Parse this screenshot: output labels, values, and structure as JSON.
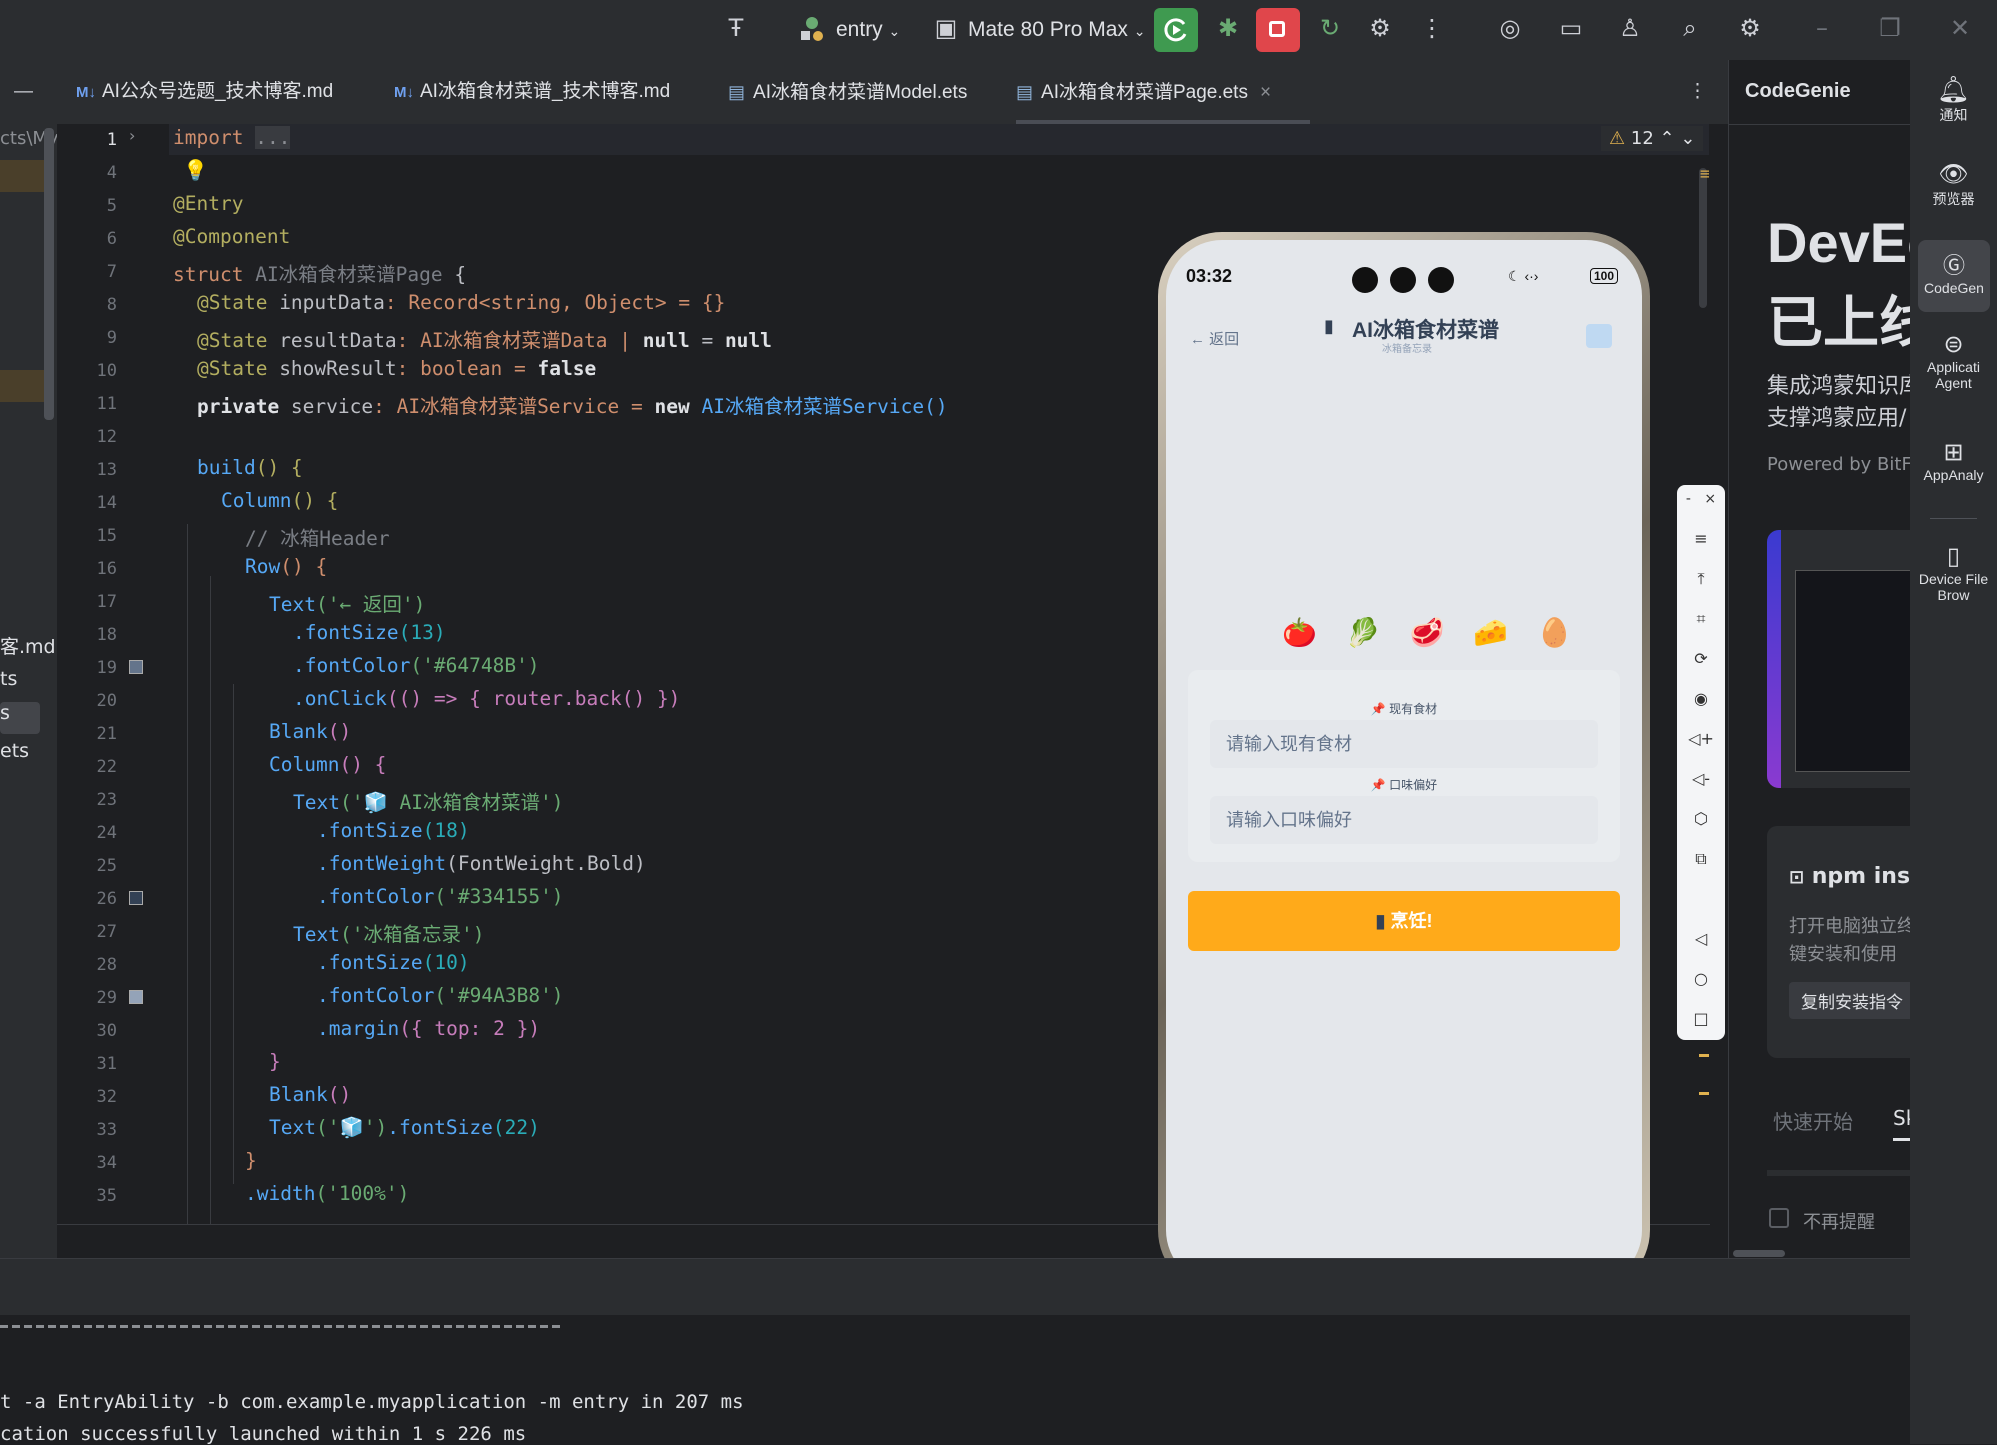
{
  "toolbar": {
    "module": "entry",
    "device": "Mate 80 Pro Max"
  },
  "tabs": [
    {
      "badge": "M↓",
      "label": "AI公众号选题_技术博客.md"
    },
    {
      "badge": "M↓",
      "label": "AI冰箱食材菜谱_技术博客.md"
    },
    {
      "badge": "",
      "label": "AI冰箱食材菜谱Model.ets"
    },
    {
      "badge": "",
      "label": "AI冰箱食材菜谱Page.ets",
      "close": "×"
    }
  ],
  "left_panel": {
    "path_fragment": "cts\\My",
    "items": [
      "客.md",
      "ts",
      "s",
      "ets"
    ]
  },
  "inspection": {
    "warnings": "12"
  },
  "line_numbers": [
    "1",
    "4",
    "5",
    "6",
    "7",
    "8",
    "9",
    "10",
    "11",
    "12",
    "13",
    "14",
    "15",
    "16",
    "17",
    "18",
    "19",
    "20",
    "21",
    "22",
    "23",
    "24",
    "25",
    "26",
    "27",
    "28",
    "29",
    "30",
    "31",
    "32",
    "33",
    "34",
    "35"
  ],
  "code": {
    "l1_kw": "import",
    "l1_fold": "...",
    "l5": "@Entry",
    "l6": "@Component",
    "l7_kw": "struct",
    "l7_name": "AI冰箱食材菜谱Page",
    "l7_brace": " {",
    "l8_ann": "@State",
    "l8_name": " inputData",
    "l8_rest": ": Record<string, Object> = {}",
    "l9_ann": "@State",
    "l9_name": " resultData",
    "l9_type": ": AI冰箱食材菜谱Data | ",
    "l9_null1": "null",
    "l9_eq": " = ",
    "l9_null2": "null",
    "l10_ann": "@State",
    "l10_name": " showResult",
    "l10_type": ": boolean = ",
    "l10_val": "false",
    "l11_kw": "private",
    "l11_name": " service",
    "l11_type": ": AI冰箱食材菜谱Service = ",
    "l11_new": "new",
    "l11_cls": " AI冰箱食材菜谱Service()",
    "l13_fn": "build",
    "l13_rest": "() {",
    "l14_fn": "Column",
    "l14_rest": "() {",
    "l15_cm": "// 冰箱Header",
    "l16_fn": "Row",
    "l16_rest": "() {",
    "l17_fn": "Text",
    "l17_str": "('← 返回')",
    "l18_prop": ".fontSize",
    "l18_num": "(13)",
    "l19_prop": ".fontColor",
    "l19_str": "('#64748B')",
    "l20_prop": ".onClick",
    "l20_rest": "(() => { router.back() })",
    "l21_fn": "Blank",
    "l21_rest": "()",
    "l22_fn": "Column",
    "l22_rest": "() {",
    "l23_fn": "Text",
    "l23_str": "('🧊 AI冰箱食材菜谱')",
    "l24_prop": ".fontSize",
    "l24_num": "(18)",
    "l25_prop": ".fontWeight",
    "l25_rest": "(FontWeight.Bold)",
    "l26_prop": ".fontColor",
    "l26_str": "('#334155')",
    "l27_fn": "Text",
    "l27_str": "('冰箱备忘录')",
    "l28_prop": ".fontSize",
    "l28_num": "(10)",
    "l29_prop": ".fontColor",
    "l29_str": "('#94A3B8')",
    "l30_prop": ".margin",
    "l30_rest": "({ top: 2 })",
    "l31": "}",
    "l32_fn": "Blank",
    "l32_rest": "()",
    "l33_fn": "Text",
    "l33_str": "('🧊')",
    "l33_prop": ".fontSize",
    "l33_num": "(22)",
    "l34": "}",
    "l35_prop": ".width",
    "l35_str": "('100%')"
  },
  "phone": {
    "time": "03:32",
    "battery": "100",
    "back": "← 返回",
    "title": "AI冰箱食材菜谱",
    "subtitle": "冰箱备忘录",
    "food_icons": "🍅 🥬 🥩 🧀 🥚",
    "label_ingredients": "📌 现有食材",
    "placeholder_ingredients": "请输入现有食材",
    "label_taste": "📌 口味偏好",
    "placeholder_taste": "请输入口味偏好",
    "cook_button": "烹饪!"
  },
  "codegenie": {
    "title": "CodeGenie",
    "headline1": "DevEc",
    "headline2": "已上线",
    "desc1": "集成鸿蒙知识库",
    "desc2": "支撑鸿蒙应用/",
    "powered": "Powered by BitFu",
    "npm_title": "npm ins",
    "npm_desc1": "打开电脑独立终",
    "npm_desc2": "键安装和使用",
    "copy_btn": "复制安装指令",
    "tab_quick": "快速开始",
    "tab_s": "Sk",
    "no_remind": "不再提醒"
  },
  "right_strip": [
    {
      "icon": "bell-icon",
      "label": "通知"
    },
    {
      "icon": "eye-icon",
      "label": "预览器"
    },
    {
      "icon": "codegenie-icon",
      "label": "CodeGen"
    },
    {
      "icon": "agent-icon",
      "label": "Applicati Agent"
    },
    {
      "icon": "analyzer-icon",
      "label": "AppAnaly"
    },
    {
      "icon": "device-icon",
      "label": "Device File Brow"
    }
  ],
  "console": {
    "line1": "t -a EntryAbility -b com.example.myapplication -m entry in 207 ms",
    "line2": "cation successfully launched within 1 s 226 ms"
  },
  "colors": {
    "cook_button": "#ffaa1a",
    "run_green": "#3f9a50",
    "stop_red": "#e0464b"
  }
}
